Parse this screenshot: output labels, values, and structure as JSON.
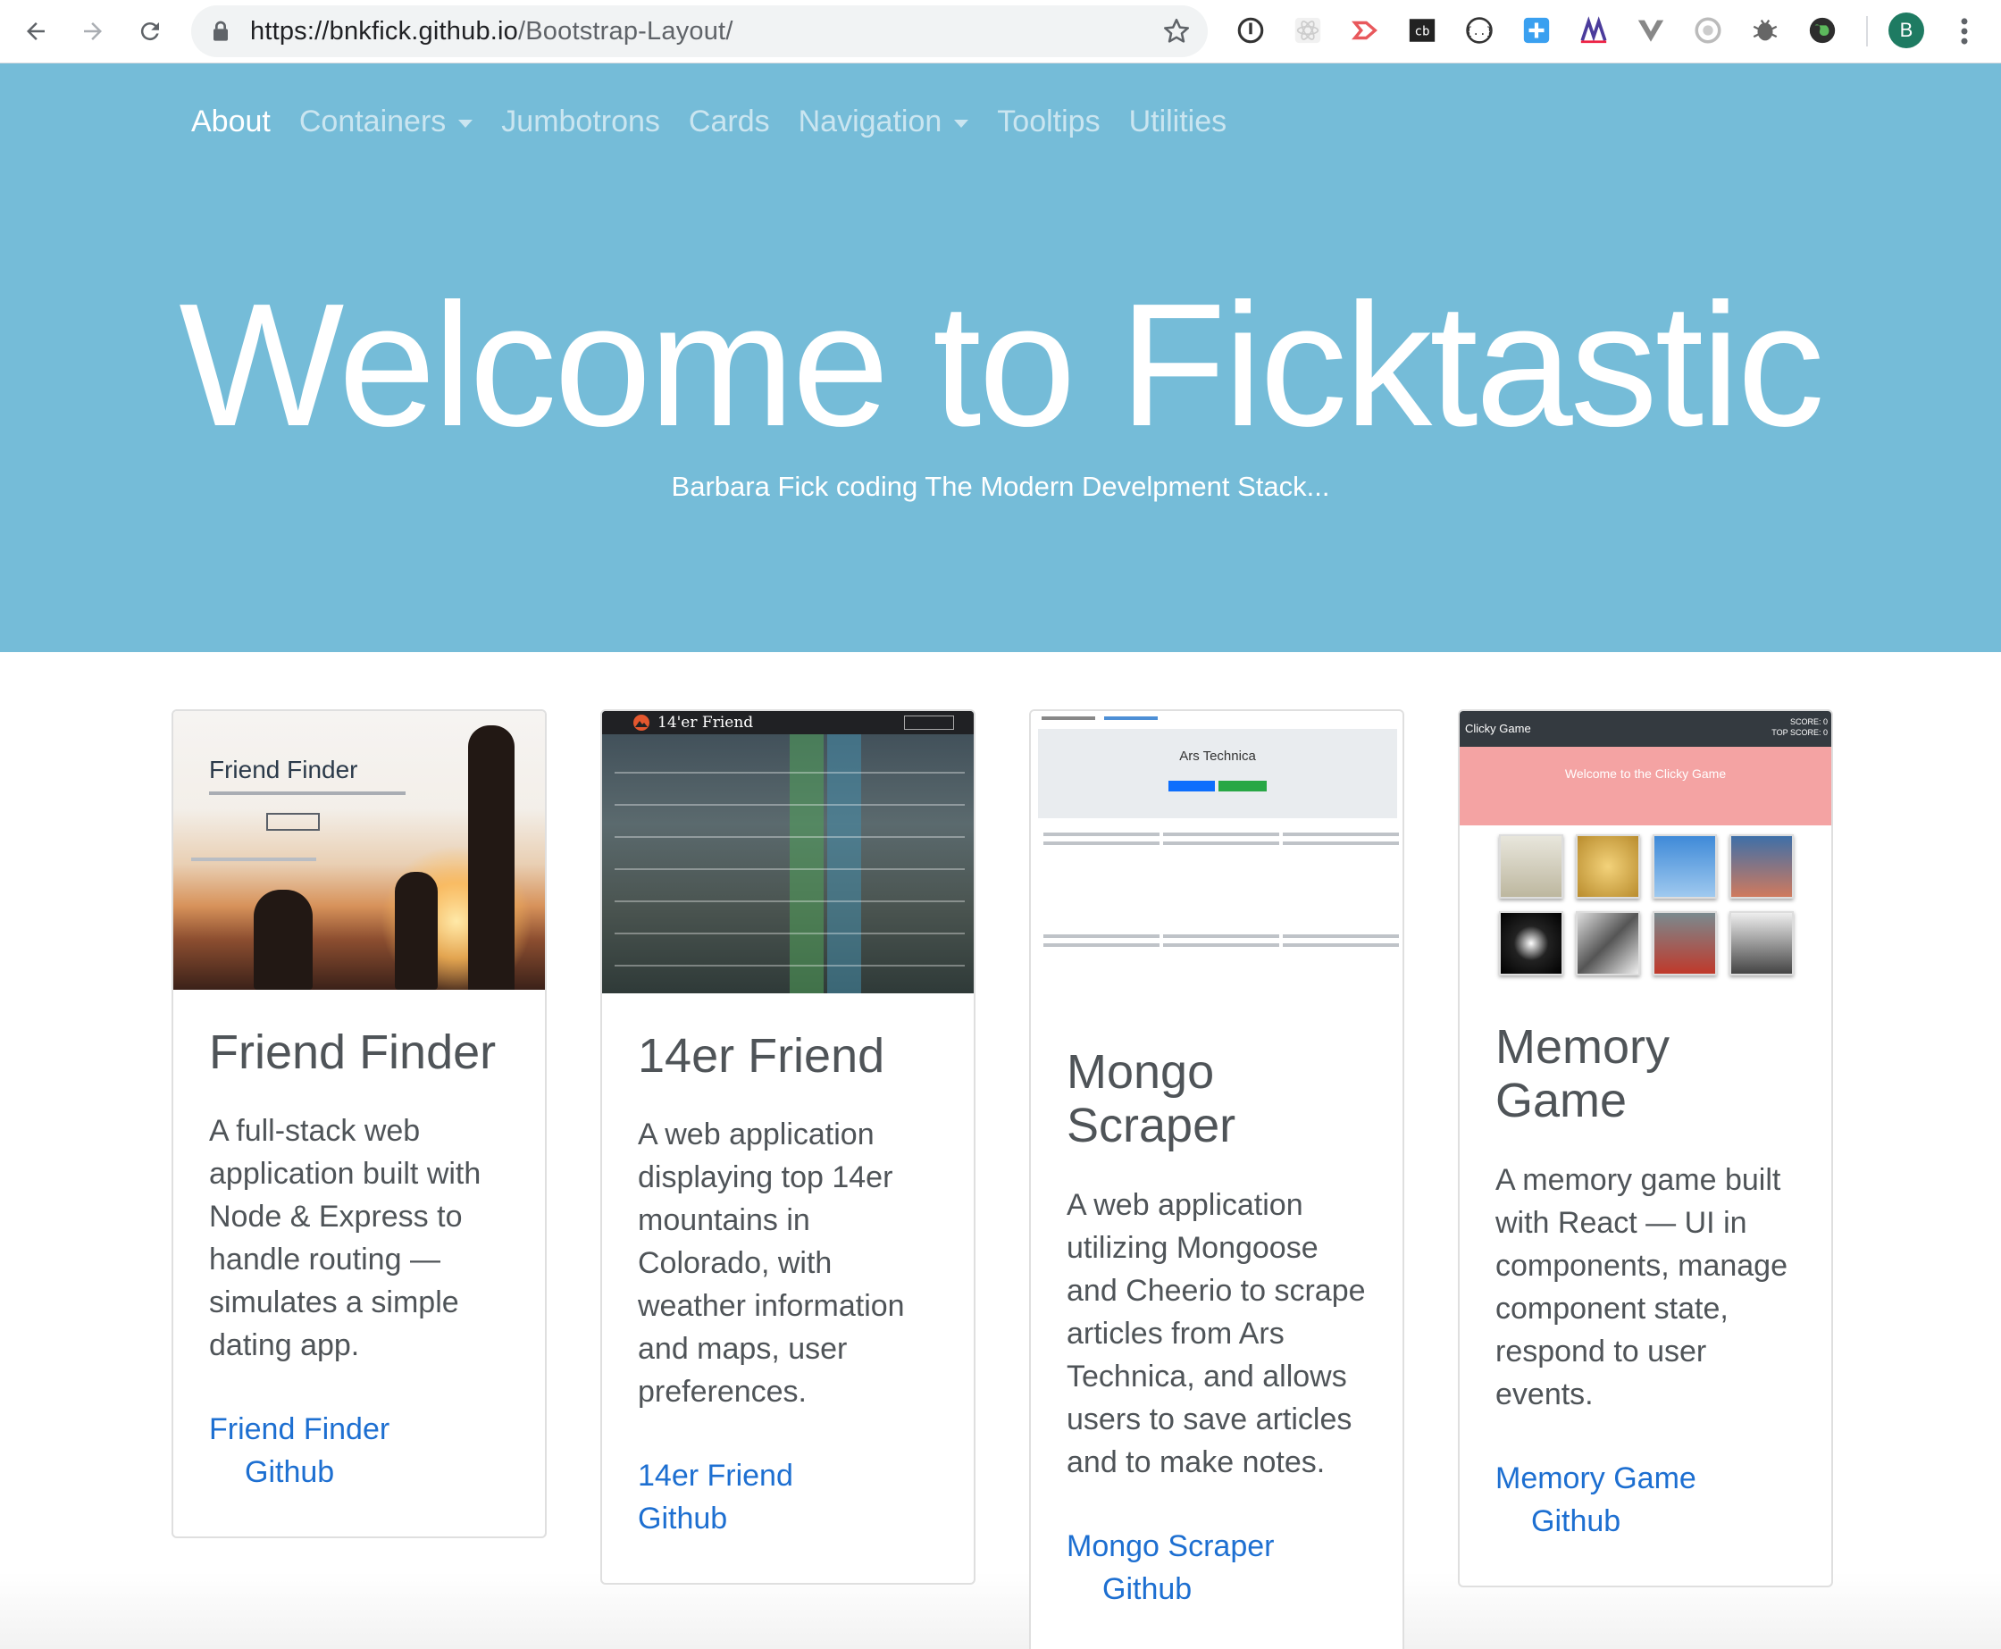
{
  "browser": {
    "url_host": "https://bnkfick.github.io",
    "url_path": "/Bootstrap-Layout/",
    "profile_initial": "B"
  },
  "navbar": {
    "items": [
      {
        "label": "About",
        "active": true,
        "dropdown": false
      },
      {
        "label": "Containers",
        "active": false,
        "dropdown": true
      },
      {
        "label": "Jumbotrons",
        "active": false,
        "dropdown": false
      },
      {
        "label": "Cards",
        "active": false,
        "dropdown": false
      },
      {
        "label": "Navigation",
        "active": false,
        "dropdown": true
      },
      {
        "label": "Tooltips",
        "active": false,
        "dropdown": false
      },
      {
        "label": "Utilities",
        "active": false,
        "dropdown": false
      }
    ]
  },
  "hero": {
    "title": "Welcome to Ficktastic",
    "subtitle": "Barbara Fick coding The Modern Develpment Stack..."
  },
  "cards": [
    {
      "title": "Friend Finder",
      "text": "A full-stack web application built with Node & Express to handle routing — simulates a simple dating app.",
      "link1": "Friend Finder",
      "link2": "Github",
      "thumb": {
        "heading": "Friend Finder"
      }
    },
    {
      "title": "14er Friend",
      "text": "A web application displaying top 14er mountains in Colorado, with weather information and maps, user preferences.",
      "link1": "14er Friend",
      "link2": "Github",
      "thumb": {
        "logo": "14'er Friend"
      }
    },
    {
      "title": "Mongo Scraper",
      "text": "A web application utilizing Mongoose and Cheerio to scrape articles from Ars Technica, and allows users to save articles and to make notes.",
      "link1": "Mongo Scraper",
      "link2": "Github",
      "thumb": {
        "heading": "Ars Technica"
      }
    },
    {
      "title": "Memory Game",
      "text": "A memory game built with React — UI in components, manage component state, respond to user events.",
      "link1": "Memory Game",
      "link2": "Github",
      "thumb": {
        "brand": "Clicky Game",
        "score": "SCORE: 0",
        "top_score": "TOP SCORE: 0",
        "banner": "Welcome to the Clicky Game"
      }
    }
  ],
  "colors": {
    "hero_bg": "#75bcd8",
    "link": "#1d6fd1",
    "card_text": "#4f5458"
  }
}
